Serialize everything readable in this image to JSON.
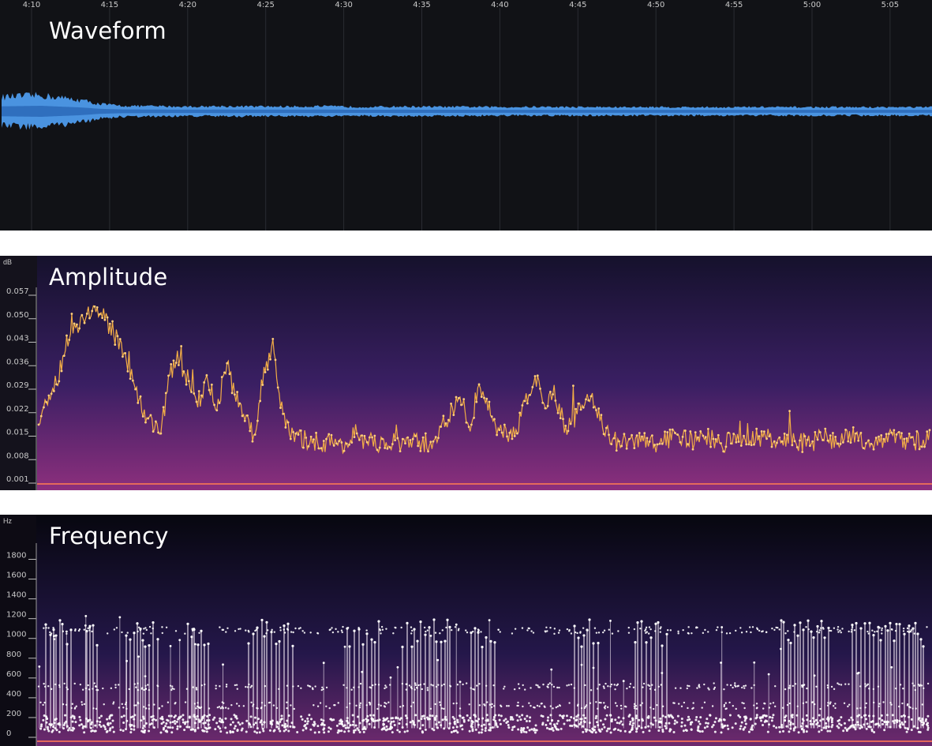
{
  "chart_data": [
    {
      "type": "area",
      "title": "Waveform",
      "x_ticks": [
        "4:10",
        "4:15",
        "4:20",
        "4:25",
        "4:30",
        "4:35",
        "4:40",
        "4:45",
        "4:50",
        "4:55",
        "5:00",
        "5:05"
      ],
      "series": [
        {
          "values": [
            0.9,
            0.95,
            1.0,
            0.85,
            0.7,
            0.45,
            0.35,
            0.33,
            0.32,
            0.3,
            0.3,
            0.32,
            0.31,
            0.3,
            0.3,
            0.3,
            0.32,
            0.3,
            0.28,
            0.28,
            0.3,
            0.29,
            0.28,
            0.28,
            0.28,
            0.27,
            0.27,
            0.28,
            0.27,
            0.27,
            0.27,
            0.26,
            0.26,
            0.27,
            0.26,
            0.26,
            0.26,
            0.26,
            0.27,
            0.26,
            0.26,
            0.26,
            0.26,
            0.26,
            0.26,
            0.26,
            0.26,
            0.26
          ]
        }
      ],
      "colors": {
        "fill": "#2f6fbe",
        "fill_light": "#4a93e0",
        "background": "#111216",
        "grid": "#2a2c32"
      }
    },
    {
      "type": "line",
      "title": "Amplitude",
      "ylabel": "dB",
      "y_ticks": [
        "0.057",
        "0.050",
        "0.043",
        "0.036",
        "0.029",
        "0.022",
        "0.015",
        "0.008",
        "0.001"
      ],
      "ylim": [
        0.001,
        0.057
      ],
      "series": [
        {
          "values": [
            0.018,
            0.025,
            0.031,
            0.043,
            0.047,
            0.05,
            0.052,
            0.049,
            0.045,
            0.04,
            0.032,
            0.022,
            0.018,
            0.016,
            0.032,
            0.038,
            0.028,
            0.024,
            0.032,
            0.02,
            0.036,
            0.026,
            0.018,
            0.014,
            0.033,
            0.042,
            0.02,
            0.014,
            0.013,
            0.013,
            0.012,
            0.012,
            0.012,
            0.012,
            0.012,
            0.012,
            0.012,
            0.012,
            0.012,
            0.012,
            0.012,
            0.012,
            0.012,
            0.017,
            0.021,
            0.025,
            0.017,
            0.03,
            0.022,
            0.016,
            0.014,
            0.016,
            0.026,
            0.031,
            0.022,
            0.028,
            0.016,
            0.019,
            0.023,
            0.027,
            0.018,
            0.013,
            0.012,
            0.012,
            0.013,
            0.012,
            0.012,
            0.013,
            0.014,
            0.013,
            0.012,
            0.014,
            0.013,
            0.012,
            0.013,
            0.012,
            0.013,
            0.014,
            0.013,
            0.012,
            0.013,
            0.012,
            0.012,
            0.013,
            0.014,
            0.012,
            0.013,
            0.014,
            0.013,
            0.012,
            0.013,
            0.014,
            0.013,
            0.012,
            0.013,
            0.014
          ]
        }
      ],
      "colors": {
        "line": "#f2ad45",
        "point": "#ffcf7a",
        "background_top": "#15112c",
        "background_mid": "#3a1f63",
        "background_bottom": "#8c2f7d",
        "baseline": "#e36a5c"
      }
    },
    {
      "type": "scatter",
      "title": "Frequency",
      "ylabel": "Hz",
      "y_ticks": [
        "1800",
        "1600",
        "1400",
        "1200",
        "1000",
        "800",
        "600",
        "400",
        "200",
        "0"
      ],
      "ylim": [
        0,
        1900
      ],
      "burst_groups": [
        [
          58,
          90
        ],
        [
          110,
          125
        ],
        [
          160,
          200
        ],
        [
          238,
          268
        ],
        [
          315,
          375
        ],
        [
          440,
          480
        ],
        [
          510,
          570
        ],
        [
          597,
          630
        ],
        [
          728,
          762
        ],
        [
          805,
          848
        ],
        [
          990,
          1050
        ],
        [
          1080,
          1170
        ]
      ],
      "bands": [
        {
          "value": 1050
        },
        {
          "value": 480
        },
        {
          "value": 290
        },
        {
          "value": 150
        },
        {
          "value": 60
        }
      ],
      "colors": {
        "stem": "#f1e7f2",
        "point": "#ffffff",
        "background_top": "#07070f",
        "background_mid": "#24174a",
        "background_bottom": "#6e2a6e"
      }
    }
  ]
}
